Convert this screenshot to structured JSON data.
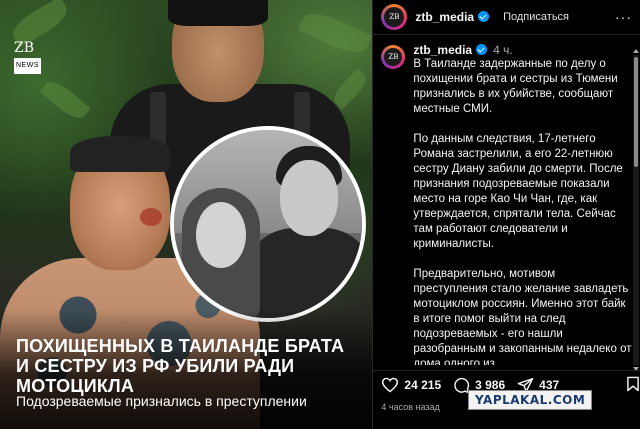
{
  "photo": {
    "logo_text": "ZB",
    "logo_sub": "NEWS",
    "headline": "ПОХИЩЕННЫХ В ТАИЛАНДЕ БРАТА И СЕСТРУ ИЗ РФ УБИЛИ РАДИ МОТОЦИКЛА",
    "subhead": "Подозреваемые признались в преступлении"
  },
  "header": {
    "username": "ztb_media",
    "follow_label": "Подписаться",
    "more_label": "···",
    "avatar_text": "ZB"
  },
  "post": {
    "username": "ztb_media",
    "time": "4 ч.",
    "text": "В Таиланде задержанные по делу о похищении брата и сестры из Тюмени признались в их убийстве, сообщают местные СМИ.\n\nПо данным следствия, 17-летнего Романа застрелили, а его 22-летнюю сестру Диану забили до смерти. После признания подозреваемые показали место на горе Као Чи Чан, где, как утверждается, спрятали тела. Сейчас там работают следователи и криминалисты.\n\nПредварительно, мотивом преступления стало желание завладеть мотоциклом россиян. Именно этот байк в итоге помог выйти на след подозреваемых - его нашли разобранным и закопанным недалеко от дома одного из"
  },
  "actions": {
    "likes": "24 215",
    "comments": "3 986",
    "shares": "437"
  },
  "time_ago": "4 часов назад",
  "watermark": "YAPLAKAL.COM"
}
